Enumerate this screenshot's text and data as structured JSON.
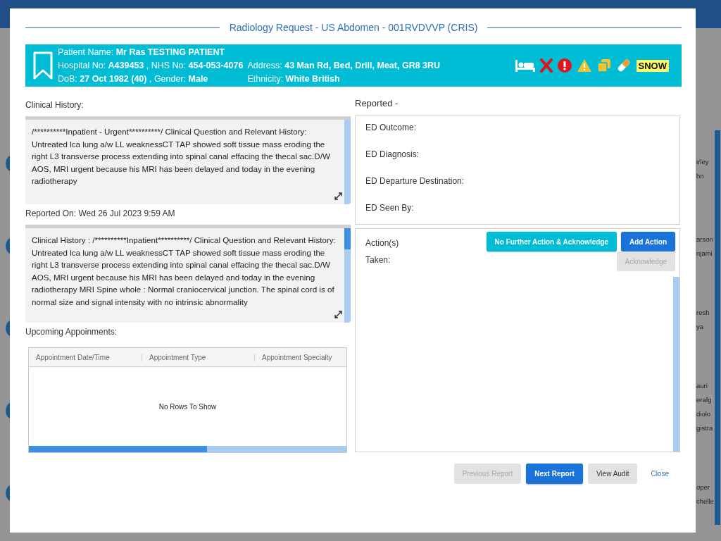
{
  "background": {
    "edge_names": [
      "irley",
      "hn",
      "arson",
      "njami",
      "resh",
      "ya",
      "auri",
      "erafg",
      "diolo",
      "gistra",
      "oper",
      "chelle"
    ]
  },
  "dialog": {
    "title": "Radiology Request - US Abdomen - 001RVDVVP (CRIS)",
    "patient": {
      "line_1": "Patient Name: **Mr Ras TESTING PATIENT**",
      "line_2": "Hospital No: **A439453** , NHS No: **454-053-4076**",
      "address": "Address: **43 Man Rd, Bed, Drill, Meat, GR8 3RU**",
      "line_3": "DoB: **27 Oct 1982 (40)** , Gender: **Male**",
      "ethnicity": "Ethnicity: **White British**",
      "badge": "SNOW"
    },
    "clinical_history_label": "Clinical History:",
    "clinical_history": " /**********Inpatient - Urgent**********/ Clinical Question and Relevant History: Untreated lca lung a/w LL weaknessCT TAP showed soft tissue mass eroding the right L3 transverse process extending into spinal canal effacing the thecal sac.D/W AOS, MRI urgent because his MRI has been delayed and today in the evening radiotherapy",
    "reported_on": "Reported On: Wed 26 Jul 2023 9:59 AM",
    "report_text": " Clinical History : /**********Inpatient**********/ Clinical Question and Relevant History: Untreated lca lung a/w LL weaknessCT TAP showed soft tissue mass eroding the right L3 transverse process extending into spinal canal effacing the thecal sac.D/W AOS, MRI urgent because his MRI has been delayed and today in the evening radiotherapy  MRI Spine whole : Normal craniocervical junction. The spinal cord is of normal size and signal intensity with no intrinsic abnormality",
    "appointments_label": "Upcoming Appoinments:",
    "appointments": {
      "columns": [
        "Appointment Date/Time",
        "Appointment Type",
        "Appointment Specialty"
      ],
      "empty_message": "No Rows To Show"
    },
    "reported_label": "Reported -",
    "ed_fields": [
      "ED Outcome:",
      "ED Diagnosis:",
      "ED Departure Destination:",
      "ED Seen By:"
    ],
    "actions": {
      "label_1": "Action(s)",
      "label_2": "Taken:",
      "buttons": [
        {
          "label": "No Further Action & Acknowledge",
          "kind": "teal",
          "disabled": false
        },
        {
          "label": "Add Action",
          "kind": "primary",
          "disabled": false
        },
        {
          "label": "Acknowledge",
          "kind": "secondary",
          "disabled": true
        }
      ]
    },
    "footer_buttons": [
      {
        "label": "Previous Report",
        "kind": "secondary",
        "disabled": true
      },
      {
        "label": "Next Report",
        "kind": "primary",
        "disabled": false
      },
      {
        "label": "View Audit",
        "kind": "secondary",
        "disabled": false
      },
      {
        "label": "Close",
        "kind": "link",
        "disabled": false
      }
    ]
  }
}
